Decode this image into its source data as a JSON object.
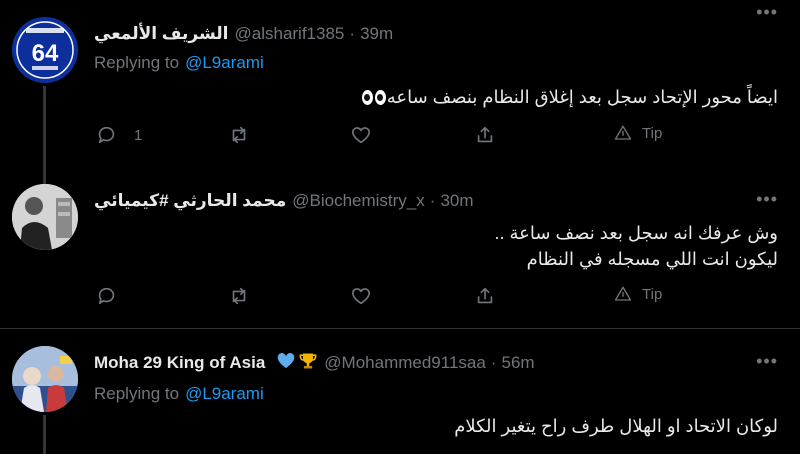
{
  "tweets": [
    {
      "name": "الشريف الألمعي",
      "handle": "@alsharif1385",
      "time": "39m",
      "replying_label": "Replying to",
      "replying_to": "@L9arami",
      "text_lines": [
        "ايضاً محور الإتحاد سجل بعد إغلاق النظام بنصف ساعه"
      ],
      "reply_count": "1",
      "tip_label": "Tip",
      "avatar_text": "64"
    },
    {
      "name": "محمد الحارثي #كيميائي",
      "handle": "@Biochemistry_x",
      "time": "30m",
      "text_lines": [
        "وش عرفك انه سجل بعد نصف ساعة ..",
        "ليكون انت اللي مسجله في النظام"
      ],
      "tip_label": "Tip"
    },
    {
      "name": "Moha 29 King of Asia",
      "handle": "@Mohammed911saa",
      "time": "56m",
      "replying_label": "Replying to",
      "replying_to": "@L9arami",
      "text_lines": [
        "لوكان الاتحاد او الهلال طرف راح يتغير الكلام"
      ]
    }
  ],
  "colors": {
    "background": "#000000",
    "mention": "#1d9bf0",
    "muted": "#71767b",
    "divider": "#2f3336"
  },
  "icons": {
    "more": "more-horizontal-icon",
    "reply": "reply-icon",
    "retweet": "retweet-icon",
    "like": "heart-icon",
    "share": "share-icon",
    "tip": "tip-icon"
  }
}
